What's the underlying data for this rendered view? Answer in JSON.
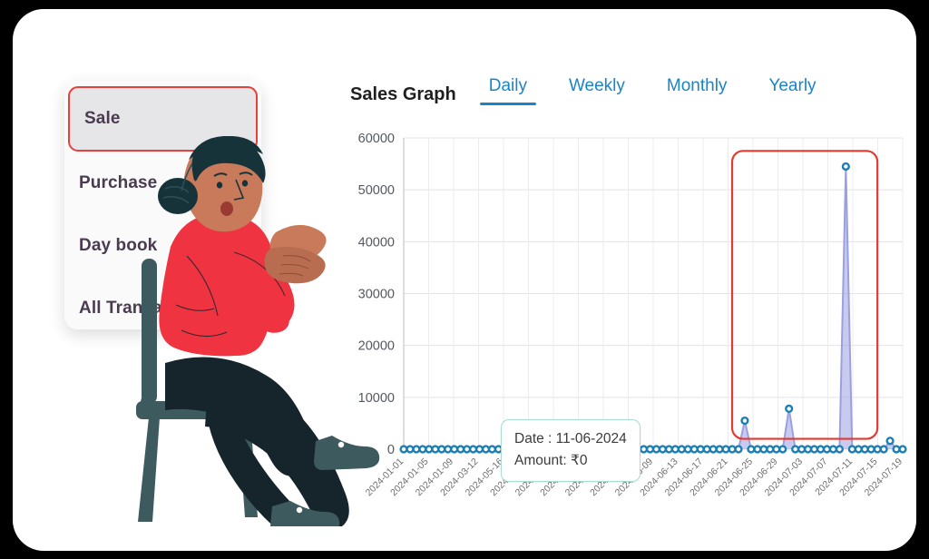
{
  "card": {
    "background": "#ffffff",
    "page_background": "#000000"
  },
  "menu": {
    "accent": "#e8403a",
    "items": [
      {
        "label": "Sale",
        "active": true
      },
      {
        "label": "Purchase",
        "active": false
      },
      {
        "label": "Day book",
        "active": false
      },
      {
        "label": "All Transaction",
        "active": false
      }
    ]
  },
  "chart_header": {
    "title": "Sales Graph",
    "tabs": [
      {
        "label": "Daily",
        "active": true
      },
      {
        "label": "Weekly",
        "active": false
      },
      {
        "label": "Monthly",
        "active": false
      },
      {
        "label": "Yearly",
        "active": false
      }
    ],
    "tab_color": "#1a84c7"
  },
  "tooltip": {
    "date_line": "Date : 11-06-2024",
    "amount_line": "Amount: ₹0",
    "border_color": "#a8ddd2"
  },
  "highlight_box": {
    "color": "#e23b32",
    "label": "peak-region-highlight"
  },
  "chart_data": {
    "type": "line",
    "title": "Sales Graph",
    "xlabel": "",
    "ylabel": "",
    "ylim": [
      0,
      60000
    ],
    "yticks": [
      0,
      10000,
      20000,
      30000,
      40000,
      50000,
      60000
    ],
    "ytick_labels": [
      "0",
      "10000",
      "20000",
      "30000",
      "40000",
      "50000",
      "60000"
    ],
    "grid": true,
    "legend": "none",
    "line_color": "#9aa0e0",
    "marker_color": "#1b7fb5",
    "tick_labels": [
      "2024-01-01",
      "2024-01-05",
      "2024-01-09",
      "2024-03-12",
      "2024-05-16",
      "2024-05-20",
      "2024-05-24",
      "2024-05-28",
      "2024-06-01",
      "2024-06-05",
      "2024-06-09",
      "2024-06-13",
      "2024-06-17",
      "2024-06-21",
      "2024-06-25",
      "2024-06-29",
      "2024-07-03",
      "2024-07-07",
      "2024-07-11",
      "2024-07-15",
      "2024-07-19"
    ],
    "x": [
      "2024-01-01",
      "2024-01-02",
      "2024-01-03",
      "2024-01-04",
      "2024-01-05",
      "2024-01-06",
      "2024-01-07",
      "2024-01-08",
      "2024-01-09",
      "2024-01-10",
      "2024-03-12",
      "2024-03-13",
      "2024-03-14",
      "2024-03-15",
      "2024-05-16",
      "2024-05-17",
      "2024-05-18",
      "2024-05-19",
      "2024-05-20",
      "2024-05-21",
      "2024-05-22",
      "2024-05-23",
      "2024-05-24",
      "2024-05-25",
      "2024-05-26",
      "2024-05-27",
      "2024-05-28",
      "2024-05-29",
      "2024-05-30",
      "2024-05-31",
      "2024-06-01",
      "2024-06-02",
      "2024-06-03",
      "2024-06-04",
      "2024-06-05",
      "2024-06-06",
      "2024-06-07",
      "2024-06-08",
      "2024-06-09",
      "2024-06-10",
      "2024-06-11",
      "2024-06-12",
      "2024-06-13",
      "2024-06-14",
      "2024-06-15",
      "2024-06-16",
      "2024-06-17",
      "2024-06-18",
      "2024-06-19",
      "2024-06-20",
      "2024-06-21",
      "2024-06-22",
      "2024-06-23",
      "2024-06-24",
      "2024-06-25",
      "2024-06-26",
      "2024-06-27",
      "2024-06-28",
      "2024-06-29",
      "2024-06-30",
      "2024-07-01",
      "2024-07-02",
      "2024-07-03",
      "2024-07-04",
      "2024-07-05",
      "2024-07-06",
      "2024-07-07",
      "2024-07-08",
      "2024-07-09",
      "2024-07-10",
      "2024-07-11",
      "2024-07-12",
      "2024-07-13",
      "2024-07-14",
      "2024-07-15",
      "2024-07-16",
      "2024-07-17",
      "2024-07-18",
      "2024-07-19",
      "2024-07-20"
    ],
    "values": [
      0,
      0,
      0,
      0,
      0,
      0,
      0,
      0,
      0,
      0,
      0,
      0,
      0,
      0,
      0,
      0,
      0,
      0,
      0,
      0,
      0,
      0,
      0,
      0,
      0,
      0,
      0,
      0,
      0,
      0,
      0,
      0,
      0,
      0,
      0,
      0,
      0,
      0,
      0,
      0,
      0,
      0,
      0,
      0,
      0,
      0,
      0,
      0,
      0,
      0,
      0,
      0,
      0,
      0,
      5500,
      0,
      0,
      0,
      0,
      0,
      0,
      7800,
      0,
      0,
      0,
      0,
      0,
      0,
      0,
      0,
      54500,
      0,
      0,
      0,
      0,
      0,
      0,
      1600,
      0,
      0
    ],
    "peaks": [
      {
        "date": "2024-06-25",
        "value": 5500
      },
      {
        "date": "2024-07-02",
        "value": 7800
      },
      {
        "date": "2024-07-11",
        "value": 54500
      },
      {
        "date": "2024-07-18",
        "value": 1600
      }
    ]
  }
}
